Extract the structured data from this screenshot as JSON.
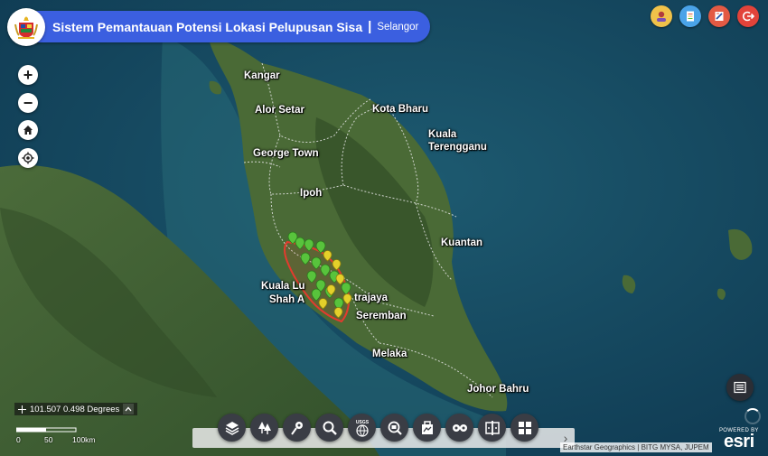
{
  "header": {
    "title": "Sistem Pemantauan Potensi Lokasi Pelupusan Sisa",
    "separator": "|",
    "subtitle": "Selangor"
  },
  "top_right_icons": [
    {
      "name": "user-profile-icon",
      "color": "#f0c24a"
    },
    {
      "name": "document-icon",
      "color": "#4aa3e8"
    },
    {
      "name": "report-icon",
      "color": "#e35a44"
    },
    {
      "name": "logout-icon",
      "color": "#e2433a"
    }
  ],
  "map_controls": {
    "zoom_in": "+",
    "zoom_out": "−",
    "home_icon": "home-icon",
    "locate_icon": "locate-icon"
  },
  "place_labels": [
    {
      "id": "kangar",
      "text": "Kangar"
    },
    {
      "id": "alor-setar",
      "text": "Alor Setar"
    },
    {
      "id": "kota-bharu",
      "text": "Kota Bharu"
    },
    {
      "id": "kuala-terengganu-1",
      "text": "Kuala"
    },
    {
      "id": "kuala-terengganu-2",
      "text": "Terengganu"
    },
    {
      "id": "george-town",
      "text": "George Town"
    },
    {
      "id": "ipoh",
      "text": "Ipoh"
    },
    {
      "id": "kuantan",
      "text": "Kuantan"
    },
    {
      "id": "kuala-lumpur",
      "text": "Kuala Lu"
    },
    {
      "id": "shah-alam",
      "text": "Shah A"
    },
    {
      "id": "putrajaya",
      "text": "trajaya"
    },
    {
      "id": "seremban",
      "text": "Seremban"
    },
    {
      "id": "melaka",
      "text": "Melaka"
    },
    {
      "id": "johor-bahru",
      "text": "Johor Bahru"
    }
  ],
  "coordinates": {
    "text": "101.507 0.498 Degrees"
  },
  "scale": {
    "labels": [
      "0",
      "50",
      "100km"
    ]
  },
  "toolbar": {
    "tools": [
      {
        "name": "layers-icon"
      },
      {
        "name": "forest-icon"
      },
      {
        "name": "measure-pin-icon"
      },
      {
        "name": "search-icon"
      },
      {
        "name": "usgs-globe-icon",
        "text": "USGS"
      },
      {
        "name": "query-icon"
      },
      {
        "name": "basemap-icon"
      },
      {
        "name": "analysis-icon"
      },
      {
        "name": "swipe-icon"
      },
      {
        "name": "grid-apps-icon"
      }
    ],
    "next_label": "›"
  },
  "attribution": "Earthstar Geographics | BITG MYSA, JUPEM",
  "esri": {
    "powered": "POWERED BY",
    "brand": "esri"
  },
  "legend_icon": "list-icon",
  "colors": {
    "header_blue": "#3b5fe0",
    "tool_dark": "#3a3d45",
    "marker_green": "#58c33c",
    "marker_yellow": "#e4d02a",
    "selangor_outline": "#e33b2e"
  }
}
